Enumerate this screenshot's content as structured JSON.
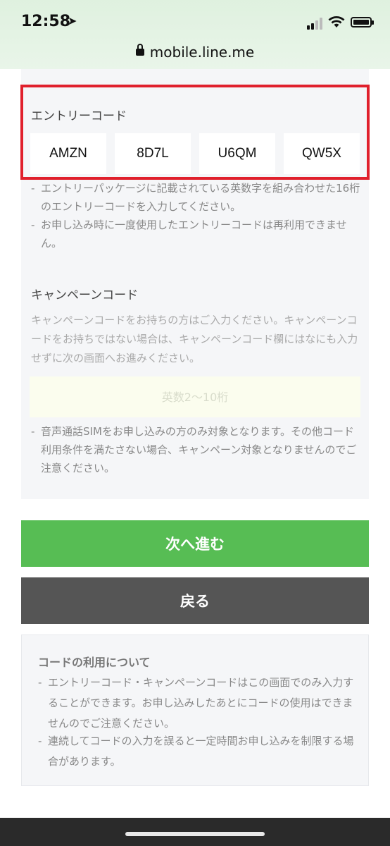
{
  "status_bar": {
    "time": "12:58",
    "location_icon": "location-arrow-icon",
    "url": "mobile.line.me"
  },
  "entry": {
    "label": "エントリーコード",
    "codes": [
      "AMZN",
      "8D7L",
      "U6QM",
      "QW5X"
    ],
    "notes": [
      "エントリーパッケージに記載されている英数字を組み合わせた16桁のエントリーコードを入力してください。",
      "お申し込み時に一度使用したエントリーコードは再利用できません。"
    ]
  },
  "campaign": {
    "label": "キャンペーンコード",
    "description": "キャンペーンコードをお持ちの方はご入力ください。キャンペーンコードをお持ちではない場合は、キャンペーンコード欄にはなにも入力せずに次の画面へお進みください。",
    "placeholder": "英数2〜10桁",
    "value": "",
    "note": "音声通話SIMをお申し込みの方のみ対象となります。その他コード利用条件を満たさない場合、キャンペーン対象となりませんのでご注意ください。"
  },
  "buttons": {
    "next": "次へ進む",
    "back": "戻る"
  },
  "info": {
    "title": "コードの利用について",
    "notes": [
      "エントリーコード・キャンペーンコードはこの画面でのみ入力することができます。お申し込みしたあとにコードの使用はできませんのでご注意ください。",
      "連続してコードの入力を誤ると一定時間お申し込みを制限する場合があります。"
    ]
  },
  "colors": {
    "accent_green": "#57bd54",
    "back_gray": "#555555",
    "highlight_red": "#e0202c"
  }
}
